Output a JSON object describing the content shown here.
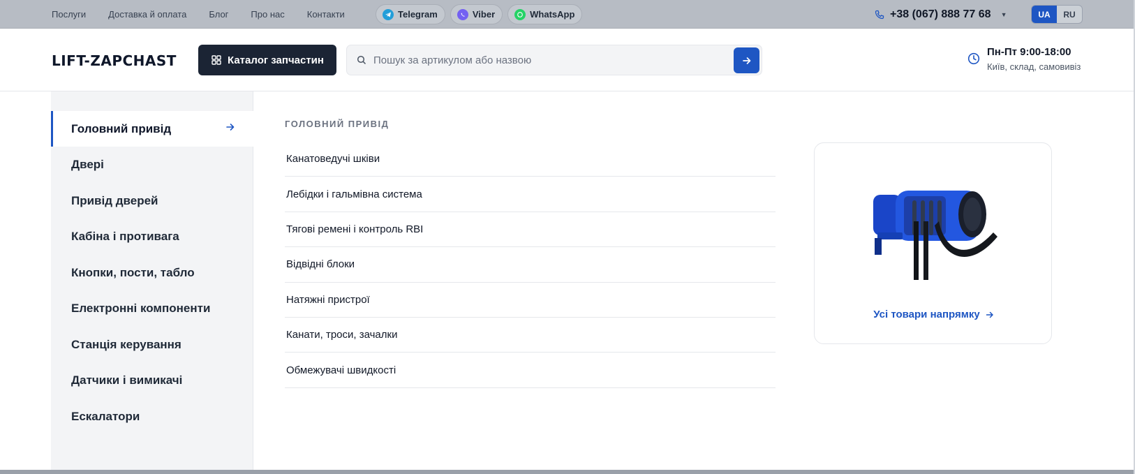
{
  "topbar": {
    "nav": [
      "Послуги",
      "Доставка й оплата",
      "Блог",
      "Про нас",
      "Контакти"
    ],
    "messengers": [
      {
        "label": "Telegram",
        "icon": "telegram-icon",
        "color": "#229ed9"
      },
      {
        "label": "Viber",
        "icon": "viber-icon",
        "color": "#7360f2"
      },
      {
        "label": "WhatsApp",
        "icon": "whatsapp-icon",
        "color": "#25d366"
      }
    ],
    "phone": "+38 (067) 888 77 68",
    "languages": [
      {
        "label": "UA",
        "active": true
      },
      {
        "label": "RU",
        "active": false
      }
    ]
  },
  "header": {
    "logo": "LIFT-ZAPCHAST",
    "catalog_label": "Каталог запчастин",
    "search_placeholder": "Пошук за артикулом або назвою",
    "search_value": "",
    "hours_title": "Пн-Пт 9:00-18:00",
    "hours_subtitle": "Київ, склад, самовивіз"
  },
  "menu": {
    "categories": [
      "Головний привід",
      "Двері",
      "Привід дверей",
      "Кабіна і противага",
      "Кнопки, пости, табло",
      "Електронні компоненти",
      "Станція керування",
      "Датчики і вимикачі",
      "Ескалатори"
    ],
    "active_index": 0,
    "panel_title": "ГОЛОВНИЙ ПРИВІД",
    "subcategories": [
      "Канатоведучі шківи",
      "Лебідки і гальмівна система",
      "Тягові ремені і контроль RBI",
      "Відвідні блоки",
      "Натяжні пристрої",
      "Канати, троси, зачалки",
      "Обмежувачі швидкості"
    ],
    "promo_link": "Усі товари напрямку"
  },
  "colors": {
    "accent": "#1e56c3",
    "dark": "#1b2434"
  }
}
